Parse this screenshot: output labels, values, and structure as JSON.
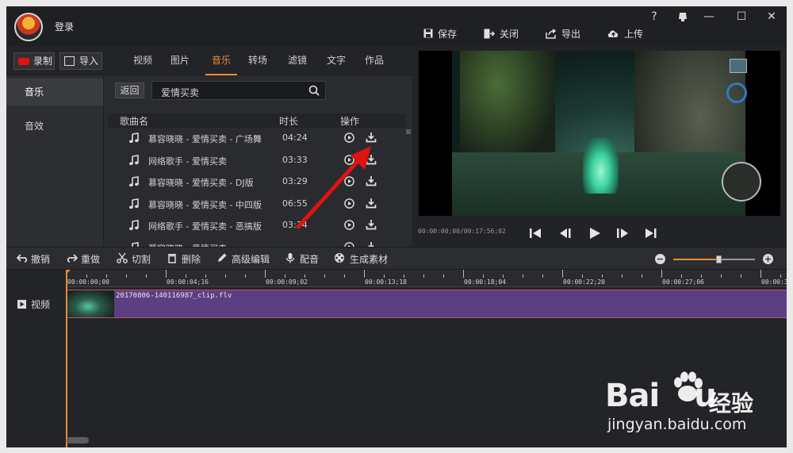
{
  "header": {
    "login": "登录",
    "help": "?",
    "min": "—",
    "max": "☐",
    "close": "✕"
  },
  "topbar": {
    "record": "录制",
    "import": "导入",
    "tabs": [
      "视频",
      "图片",
      "音乐",
      "转场",
      "滤镜",
      "文字",
      "作品"
    ],
    "active_tab": "音乐"
  },
  "subnav": [
    "音乐",
    "音效"
  ],
  "search": {
    "back": "返回",
    "query": "爱情买卖"
  },
  "table": {
    "headers": [
      "歌曲名",
      "时长",
      "操作"
    ],
    "rows": [
      {
        "name": "慕容晓晓 - 爱情买卖 - 广场舞",
        "duration": "04:24"
      },
      {
        "name": "网络歌手 - 爱情买卖",
        "duration": "03:33"
      },
      {
        "name": "慕容晓晓 - 爱情买卖 - DJ版",
        "duration": "03:29"
      },
      {
        "name": "慕容晓晓 - 爱情买卖 - 中四版",
        "duration": "06:55"
      },
      {
        "name": "网络歌手 - 爱情买卖 - 恶搞版",
        "duration": "03:34"
      },
      {
        "name": "慕容晓晓 - 爱情买卖",
        "duration": ""
      }
    ]
  },
  "actions": {
    "save": "保存",
    "close": "关闭",
    "export": "导出",
    "upload": "上传"
  },
  "player": {
    "timecode": "00:00:00;00/00:17:56;02"
  },
  "edit_tools": {
    "undo": "撤销",
    "redo": "重做",
    "cut": "切割",
    "delete": "删除",
    "advanced": "高级编辑",
    "dub": "配音",
    "generate": "生成素材",
    "zoom_level": 0.55
  },
  "timeline": {
    "track": "视频",
    "clip": "20170806-140116987_clip.flv",
    "ticks": [
      "00:00:00;00",
      "00:00:04;16",
      "00:00:09;02",
      "00:00:13;18",
      "00:00:18;04",
      "00:00:22;20",
      "00:00:27;06",
      "00:00:3"
    ]
  },
  "watermark": {
    "brand": "Bai",
    "brand_end": "u",
    "cn": "经验",
    "url": "jingyan.baidu.com"
  },
  "colors": {
    "accent": "#f08a34",
    "clip": "#5b3f82",
    "arrow": "#e01212"
  }
}
